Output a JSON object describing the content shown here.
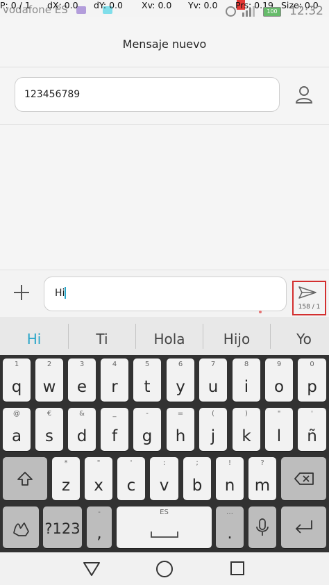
{
  "status_bar": {
    "carrier": "vodafone ES",
    "time": "12:32",
    "battery": "100",
    "debug": {
      "p": "P: 0 / 1",
      "dx": "dX: 0.0",
      "dy": "dY: 0.0",
      "xv": "Xv: 0.0",
      "yv": "Yv: 0.0",
      "prs": "Prs: 0.19",
      "size": "Size: 0.0"
    }
  },
  "header": {
    "title": "Mensaje nuevo"
  },
  "recipient": {
    "value": "123456789"
  },
  "compose": {
    "value": "Hi",
    "counter": "158 / 1"
  },
  "suggestions": [
    "Hi",
    "Ti",
    "Hola",
    "Hijo",
    "Yo"
  ],
  "keyboard": {
    "row1": [
      {
        "k": "q",
        "h": "1"
      },
      {
        "k": "w",
        "h": "2"
      },
      {
        "k": "e",
        "h": "3"
      },
      {
        "k": "r",
        "h": "4"
      },
      {
        "k": "t",
        "h": "5"
      },
      {
        "k": "y",
        "h": "6"
      },
      {
        "k": "u",
        "h": "7"
      },
      {
        "k": "i",
        "h": "8"
      },
      {
        "k": "o",
        "h": "9"
      },
      {
        "k": "p",
        "h": "0"
      }
    ],
    "row2": [
      {
        "k": "a",
        "h": "@"
      },
      {
        "k": "s",
        "h": "€"
      },
      {
        "k": "d",
        "h": "&"
      },
      {
        "k": "f",
        "h": "_"
      },
      {
        "k": "g",
        "h": "-"
      },
      {
        "k": "h",
        "h": "="
      },
      {
        "k": "j",
        "h": "("
      },
      {
        "k": "k",
        "h": ")"
      },
      {
        "k": "l",
        "h": "\""
      },
      {
        "k": "ñ",
        "h": "'"
      }
    ],
    "row3": [
      {
        "k": "z",
        "h": "*"
      },
      {
        "k": "x",
        "h": "\""
      },
      {
        "k": "c",
        "h": "'"
      },
      {
        "k": "v",
        "h": ":"
      },
      {
        "k": "b",
        "h": ";"
      },
      {
        "k": "n",
        "h": "!"
      },
      {
        "k": "m",
        "h": "?"
      }
    ],
    "symbols_label": "?123",
    "comma": ",",
    "comma_hint": "-",
    "space_label": "ES",
    "period": ".",
    "period_hint": "…"
  }
}
